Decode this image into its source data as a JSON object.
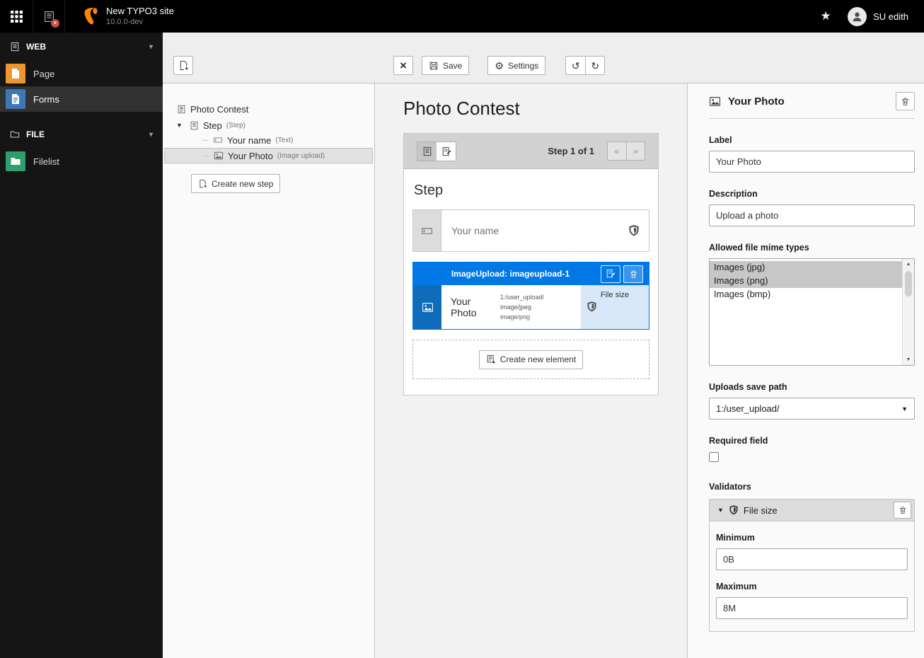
{
  "colors": {
    "accent_blue": "#0078e6",
    "typo3_orange": "#ff8700",
    "module_page": "#ec9533",
    "module_forms": "#3d77b5",
    "module_filelist": "#2f9e6e",
    "badge_red": "#c24e4e",
    "selected_option_gray": "#c7c7c7"
  },
  "icons": {
    "star": "★",
    "gear": "⚙",
    "undo": "↺",
    "redo": "↻",
    "close": "×",
    "caret_down": "▾",
    "caret_solid": "▼",
    "prev": "«",
    "next": "»",
    "scroll_up": "▲",
    "scroll_down": "▼",
    "select_arrow": "▼",
    "badge_x": "×"
  },
  "topbar": {
    "site_name": "New TYPO3 site",
    "site_version": "10.0.0-dev",
    "username": "SU edith"
  },
  "sidebar": {
    "web_section": "WEB",
    "file_section": "FILE",
    "page": "Page",
    "forms": "Forms",
    "filelist": "Filelist"
  },
  "docheader": {
    "save": "Save",
    "settings": "Settings"
  },
  "tree": {
    "root": "Photo Contest",
    "step": "Step",
    "step_type": "(Step)",
    "name": "Your name",
    "name_type": "(Text)",
    "photo": "Your Photo",
    "photo_type": "(Image upload)",
    "create_step": "Create new step"
  },
  "stage": {
    "title": "Photo Contest",
    "pagination": "Step 1 of 1",
    "step_heading": "Step",
    "name_placeholder": "Your name",
    "element": {
      "header": "ImageUpload: imageupload-1",
      "label": "Your Photo",
      "detail_line1": "1:/user_upload/",
      "detail_line2": "image/jpeg",
      "detail_line3": "image/png",
      "badge": "File size"
    },
    "create_element": "Create new element"
  },
  "inspector": {
    "title": "Your Photo",
    "label": {
      "label": "Label",
      "value": "Your Photo"
    },
    "description": {
      "label": "Description",
      "value": "Upload a photo"
    },
    "mime": {
      "label": "Allowed file mime types",
      "options": [
        "Images (jpg)",
        "Images (png)",
        "Images (bmp)"
      ]
    },
    "save_path": {
      "label": "Uploads save path",
      "value": "1:/user_upload/"
    },
    "required": {
      "label": "Required field"
    },
    "validators": {
      "label": "Validators",
      "name": "File size",
      "minimum": {
        "label": "Minimum",
        "value": "0B"
      },
      "maximum": {
        "label": "Maximum",
        "value": "8M"
      }
    }
  }
}
